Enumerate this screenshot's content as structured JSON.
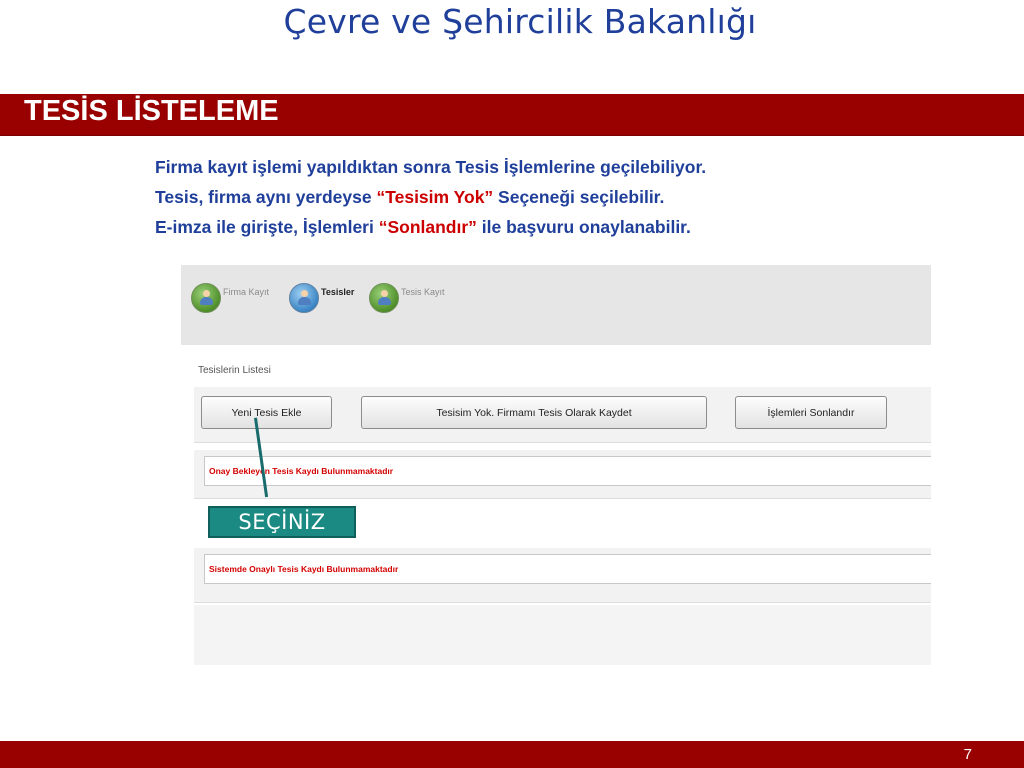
{
  "slide": {
    "title": "Çevre ve Şehircilik Bakanlığı",
    "section_title": "TESİS LİSTELEME",
    "instructions": {
      "line1": "Firma kayıt işlemi yapıldıktan sonra Tesis İşlemlerine geçilebiliyor.",
      "line2_before": "Tesis, firma aynı yerdeyse ",
      "line2_quote": "“Tesisim Yok”",
      "line2_after": " Seçeneği seçilebilir.",
      "line3_before": "E-imza ile girişte, İşlemleri ",
      "line3_quote": "“Sonlandır”",
      "line3_after": " ile başvuru onaylanabilir."
    },
    "page_number": "7"
  },
  "screenshot": {
    "tabs": [
      {
        "label": "Firma Kayıt",
        "icon": "user-icon",
        "color": "green",
        "active": false
      },
      {
        "label": "Tesisler",
        "icon": "user-icon",
        "color": "blue",
        "active": true
      },
      {
        "label": "Tesis Kayıt",
        "icon": "user-icon",
        "color": "green",
        "active": false
      }
    ],
    "list_title": "Tesislerin Listesi",
    "buttons": {
      "new_facility": "Yeni Tesis Ekle",
      "no_facility": "Tesisim Yok. Firmamı Tesis Olarak Kaydet",
      "finish": "İşlemleri Sonlandır"
    },
    "messages": {
      "pending": "Onay Bekleyen Tesis Kaydı Bulunmamaktadır",
      "approved": "Sistemde Onaylı Tesis Kaydı Bulunmamaktadır"
    }
  },
  "callout": {
    "label": "SEÇİNİZ"
  },
  "colors": {
    "title_blue": "#1f3f9a",
    "band_red": "#990000",
    "quote_red": "#cc0000",
    "message_red": "#d40000",
    "callout_teal": "#1a8a82"
  }
}
